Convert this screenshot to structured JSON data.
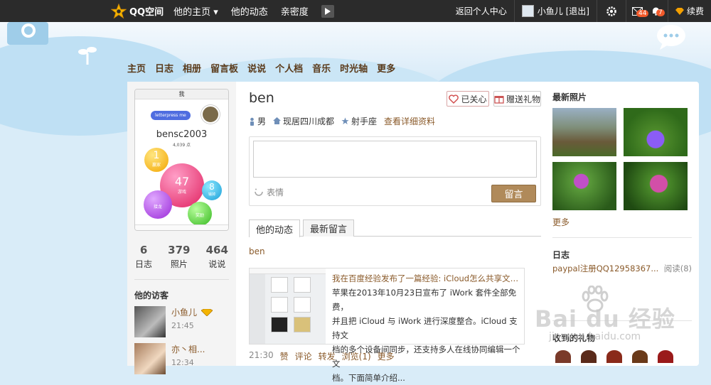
{
  "topbar": {
    "logo_text": "QQ空间",
    "nav": [
      "他的主页 ▾",
      "他的动态",
      "亲密度"
    ],
    "center_link": "返回个人中心",
    "user": "小鱼儿 [退出]",
    "mail_badge": "44",
    "notify_badge": "7",
    "renew": "续费"
  },
  "nav": [
    "主页",
    "日志",
    "相册",
    "留言板",
    "说说",
    "个人档",
    "音乐",
    "时光轴",
    "更多"
  ],
  "profile": {
    "name": "ben",
    "follow": "已关心",
    "gift": "赠送礼物",
    "gender": "男",
    "location": "现居四川成都",
    "sign": "射手座",
    "details": "查看详细资料",
    "phone_header": "我",
    "phone_bubble": "letterpress me",
    "phone_user": "bensc2003",
    "phone_score": "4,039 点",
    "bubbles": [
      {
        "num": "1",
        "label": "赢家"
      },
      {
        "num": "47",
        "label": "游戏"
      },
      {
        "num": "8",
        "label": "输掉"
      },
      {
        "num": "",
        "label": "接龙"
      },
      {
        "num": "",
        "label": "奖励"
      }
    ]
  },
  "stats": [
    {
      "n": "6",
      "l": "日志"
    },
    {
      "n": "379",
      "l": "照片"
    },
    {
      "n": "464",
      "l": "说说"
    }
  ],
  "visitors": {
    "title": "他的访客",
    "items": [
      {
        "name": "小鱼儿",
        "time": "21:45"
      },
      {
        "name": "亦丶相...",
        "time": "12:34"
      }
    ]
  },
  "message": {
    "emoji": "表情",
    "post": "留言"
  },
  "tabs": [
    "他的动态",
    "最新留言"
  ],
  "feed": {
    "author": "ben",
    "title": "我在百度经验发布了一篇经验: iCloud怎么共享文档 iC...",
    "lines": [
      "苹果在2013年10月23日宣布了 iWork 套件全部免费，",
      "并且把 iCloud 与 iWork 进行深度整合。iCloud 支持文",
      "档的多个设备间同步，还支持多人在线协同编辑一个文",
      "档。下面简单介绍..."
    ],
    "time": "21:30",
    "actions": [
      "赞",
      "评论",
      "转发",
      "浏览(1)",
      "更多"
    ]
  },
  "right": {
    "photos_title": "最新照片",
    "photos_more": "更多",
    "blog_title": "日志",
    "blog_item": "paypal注册QQ12958367...",
    "blog_reads": "阅读(8)",
    "gifts_title": "收到的礼物"
  },
  "watermark": "Bai du 经验",
  "watermark_url": "jingyan.baidu.com"
}
